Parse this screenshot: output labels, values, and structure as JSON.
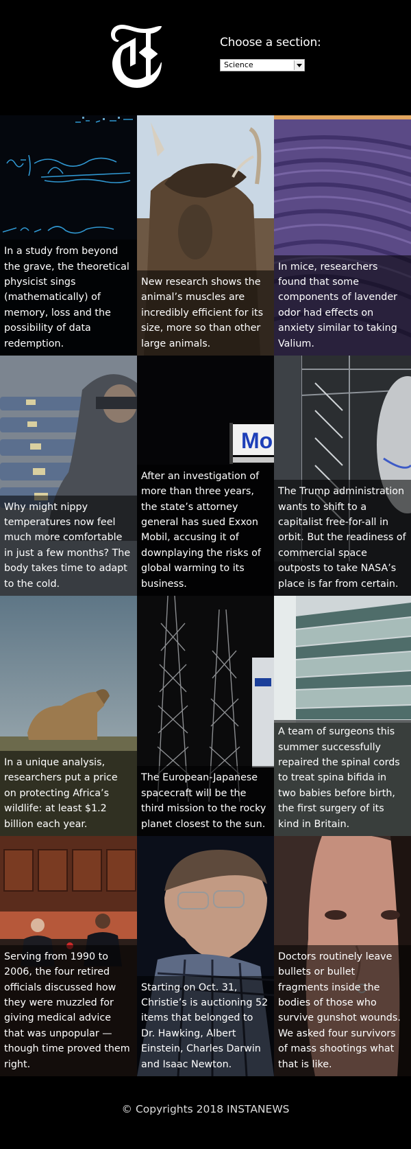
{
  "header": {
    "logo": "nyt-t-logo",
    "chooser_label": "Choose a section:",
    "section_select": {
      "selected": "Science"
    }
  },
  "articles": [
    {
      "abstract": "In a study from beyond the grave, the theoretical physicist sings (mathematically) of memory, loss and the possibility of data redemption."
    },
    {
      "abstract": "New research shows the animal’s muscles are incredibly efficient for its size, more so than other large animals."
    },
    {
      "abstract": "In mice, researchers found that some components of lavender odor had effects on anxiety similar to taking Valium."
    },
    {
      "abstract": "Why might nippy temperatures now feel much more comfortable in just a few months? The body takes time to adapt to the cold."
    },
    {
      "abstract": "After an investigation of more than three years, the state’s attorney general has sued Exxon Mobil, accusing it of downplaying the risks of global warming to its business.",
      "photo_text": "Mo"
    },
    {
      "abstract": "The Trump administration wants to shift to a capitalist free-for-all in orbit. But the readiness of commercial space outposts to take NASA’s place is far from certain."
    },
    {
      "abstract": "In a unique analysis, researchers put a price on protecting Africa’s wildlife: at least $1.2 billion each year."
    },
    {
      "abstract": "The European-Japanese spacecraft will be the third mission to the rocky planet closest to the sun."
    },
    {
      "abstract": "A team of surgeons this summer successfully repaired the spinal cords to treat spina bifida in two babies before birth, the first surgery of its kind in Britain."
    },
    {
      "abstract": "Serving from 1990 to 2006, the four retired officials discussed how they were muzzled for giving medical advice that was unpopular — though time proved them right."
    },
    {
      "abstract": "Starting on Oct. 31, Christie’s is auctioning 52 items that belonged to Dr. Hawking, Albert Einstein, Charles Darwin and Isaac Newton."
    },
    {
      "abstract": "Doctors routinely leave bullets or bullet fragments inside the bodies of those who survive gunshot wounds. We asked four survivors of mass shootings what that is like."
    }
  ],
  "footer": {
    "text": "© Copyrights 2018 INSTANEWS"
  },
  "colors": {
    "background": "#000000",
    "caption_overlay": "rgba(0,0,0,0.55)",
    "text": "#ffffff"
  }
}
